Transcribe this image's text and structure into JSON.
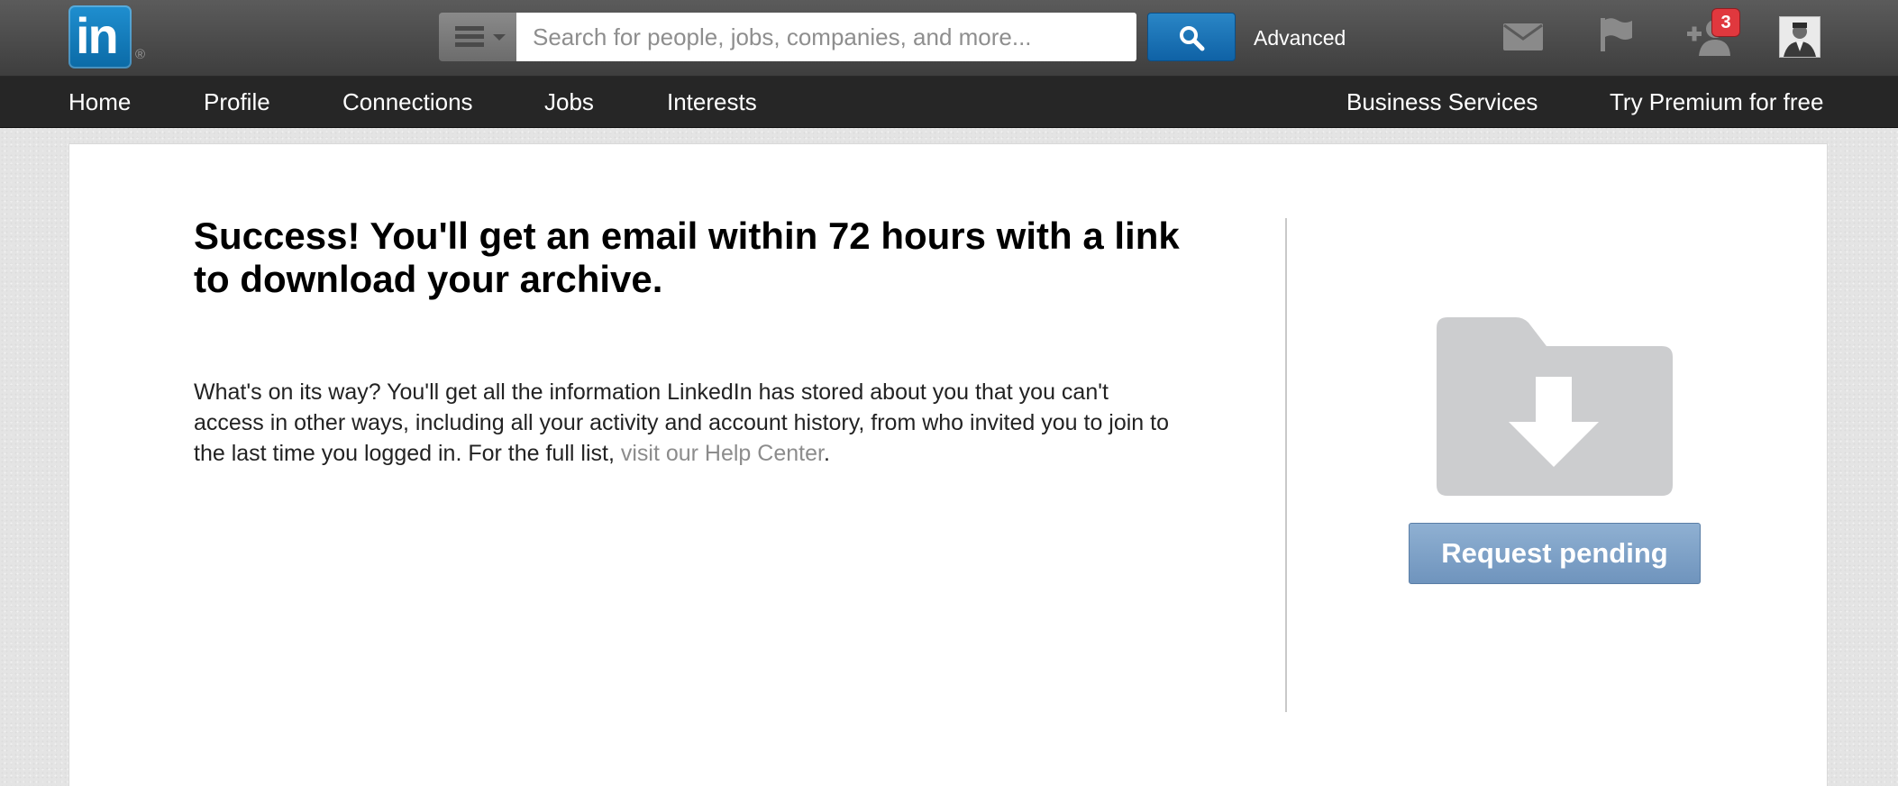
{
  "header": {
    "logo_text": "in",
    "logo_reg": "®",
    "search": {
      "placeholder": "Search for people, jobs, companies, and more...",
      "value": ""
    },
    "advanced_label": "Advanced",
    "notifications": {
      "count": "3"
    },
    "icons": {
      "category": "menu-icon",
      "search": "magnifier-icon",
      "messages": "envelope-icon",
      "notifications": "flag-icon",
      "invitations": "add-connection-icon"
    }
  },
  "nav": {
    "left": [
      "Home",
      "Profile",
      "Connections",
      "Jobs",
      "Interests"
    ],
    "right": [
      "Business Services",
      "Try Premium for free"
    ]
  },
  "main": {
    "headline": "Success! You'll get an email within 72 hours with a link to download your archive.",
    "body_text": "What's on its way? You'll get all the information LinkedIn has stored about you that you can't access in other ways, including all your activity and account history, from who invited you to join to the last time you logged in. For the full list, ",
    "help_link": "visit our Help Center",
    "body_end": ".",
    "button_label": "Request pending",
    "illustration": "folder-download-icon"
  },
  "colors": {
    "brand": "#0b6aa6",
    "search_button": "#1a73b8",
    "pending_button": "#7d9fc6",
    "badge": "#e0383e",
    "link": "#8c8c8c"
  }
}
